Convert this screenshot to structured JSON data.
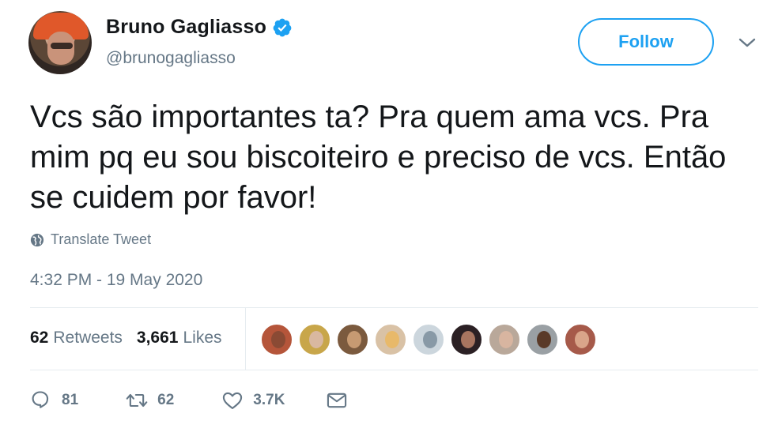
{
  "user": {
    "display_name": "Bruno Gagliasso",
    "handle": "@brunogagliasso",
    "verified": true
  },
  "follow_label": "Follow",
  "tweet": {
    "text": "Vcs são importantes ta? Pra quem ama vcs. Pra mim pq eu sou biscoiteiro e preciso de vcs. Então se cuidem por favor!",
    "translate_label": "Translate Tweet",
    "timestamp": "4:32 PM - 19 May 2020"
  },
  "stats": {
    "retweets_count": "62",
    "retweets_label": "Retweets",
    "likes_count": "3,661",
    "likes_label": "Likes"
  },
  "likers": [
    {
      "bg": "#b5553a",
      "face": "#8a4a34"
    },
    {
      "bg": "#c8a64a",
      "face": "#d9b8a0"
    },
    {
      "bg": "#7b5a3e",
      "face": "#c79a72"
    },
    {
      "bg": "#d9c2a6",
      "face": "#e8b96a"
    },
    {
      "bg": "#ccd6dd",
      "face": "#8899a6"
    },
    {
      "bg": "#2b2024",
      "face": "#a87560"
    },
    {
      "bg": "#b9a89a",
      "face": "#d8b5a0"
    },
    {
      "bg": "#9aa0a4",
      "face": "#5a3a28"
    },
    {
      "bg": "#a65a4a",
      "face": "#d9a58a"
    }
  ],
  "actions": {
    "replies": "81",
    "retweets": "62",
    "likes": "3.7K"
  },
  "colors": {
    "accent": "#1da1f2",
    "secondary_text": "#657786",
    "primary_text": "#14171a",
    "divider": "#e6ecf0"
  },
  "icons": {
    "verified": "verified-badge-icon",
    "chevron": "chevron-down-icon",
    "globe": "globe-icon",
    "reply": "reply-icon",
    "retweet": "retweet-icon",
    "like": "heart-icon",
    "dm": "envelope-icon"
  }
}
